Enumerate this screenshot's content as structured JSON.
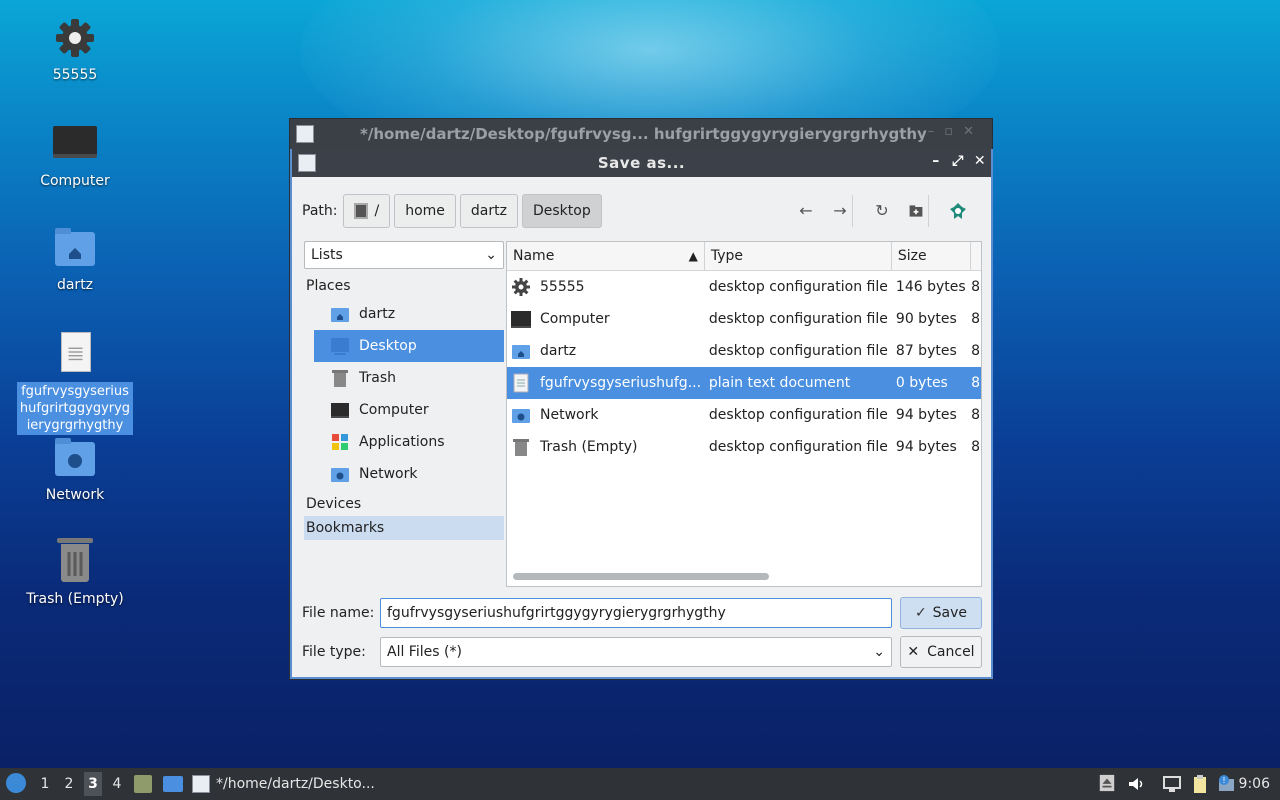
{
  "desktop": {
    "icons": [
      {
        "label": "55555",
        "icon": "gear-icon"
      },
      {
        "label": "Computer",
        "icon": "monitor-icon"
      },
      {
        "label": "dartz",
        "icon": "home-folder-icon"
      },
      {
        "label": "fgufrvysgyserius\nhufgrirtggygyryg\nierygrgrhygthy",
        "icon": "text-document-icon"
      },
      {
        "label": "Network",
        "icon": "network-folder-icon"
      },
      {
        "label": "Trash (Empty)",
        "icon": "trash-icon"
      }
    ]
  },
  "bg_window": {
    "title": "*/home/dartz/Desktop/fgufrvysg...  hufgrirtggygyrygierygrgrhygthy"
  },
  "dialog": {
    "title": "Save as...",
    "path_label": "Path:",
    "crumbs": [
      "/",
      "home",
      "dartz",
      "Desktop"
    ],
    "view_mode": "Lists",
    "places_heading": "Places",
    "places": [
      {
        "label": "dartz",
        "icon": "home-folder-icon"
      },
      {
        "label": "Desktop",
        "icon": "desktop-icon"
      },
      {
        "label": "Trash",
        "icon": "trash-icon"
      },
      {
        "label": "Computer",
        "icon": "monitor-icon"
      },
      {
        "label": "Applications",
        "icon": "applications-icon"
      },
      {
        "label": "Network",
        "icon": "network-folder-icon"
      }
    ],
    "devices_heading": "Devices",
    "bookmarks_heading": "Bookmarks",
    "columns": [
      "Name",
      "Type",
      "Size"
    ],
    "files": [
      {
        "name": "55555",
        "type": "desktop configuration file",
        "size": "146 bytes",
        "extra": "8",
        "icon": "gear-icon"
      },
      {
        "name": "Computer",
        "type": "desktop configuration file",
        "size": "90 bytes",
        "extra": "8",
        "icon": "monitor-icon"
      },
      {
        "name": "dartz",
        "type": "desktop configuration file",
        "size": "87 bytes",
        "extra": "8",
        "icon": "home-folder-icon"
      },
      {
        "name": "fgufrvysgyseriushufg...",
        "type": "plain text document",
        "size": "0 bytes",
        "extra": "8",
        "icon": "text-document-icon"
      },
      {
        "name": "Network",
        "type": "desktop configuration file",
        "size": "94 bytes",
        "extra": "8",
        "icon": "network-folder-icon"
      },
      {
        "name": "Trash (Empty)",
        "type": "desktop configuration file",
        "size": "94 bytes",
        "extra": "8",
        "icon": "trash-icon"
      }
    ],
    "selected_file_index": 3,
    "filename_label": "File name:",
    "filename_value": "fgufrvysgyseriushufgrirtggygyrygierygrgrhygthy",
    "filetype_label": "File type:",
    "filetype_value": "All Files (*)",
    "save_label": "Save",
    "cancel_label": "Cancel"
  },
  "taskbar": {
    "workspaces": [
      "1",
      "2",
      "3",
      "4"
    ],
    "current_workspace": "3",
    "task_label": "*/home/dartz/Deskto...",
    "clock": "9:06"
  },
  "colors": {
    "selection": "#4a8fe0",
    "titlebar": "#3c4048",
    "taskbar": "#2f3237"
  }
}
